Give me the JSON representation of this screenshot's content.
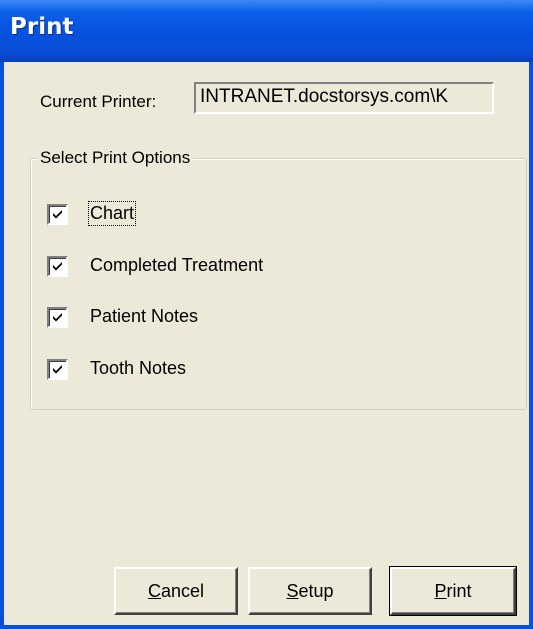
{
  "window": {
    "title": "Print"
  },
  "printer": {
    "label": "Current Printer:",
    "value": "INTRANET.docstorsys.com\\K"
  },
  "options": {
    "group_title": "Select Print Options",
    "items": [
      {
        "label": "Chart",
        "checked": true
      },
      {
        "label": "Completed Treatment",
        "checked": true
      },
      {
        "label": "Patient Notes",
        "checked": true
      },
      {
        "label": "Tooth Notes",
        "checked": true
      }
    ]
  },
  "buttons": {
    "cancel": {
      "mnemonic": "C",
      "rest": "ancel"
    },
    "setup": {
      "mnemonic": "S",
      "rest": "etup"
    },
    "print": {
      "mnemonic": "P",
      "rest": "rint"
    }
  },
  "colors": {
    "titlebar": "#0a4fd8",
    "dialog_bg": "#ece9d8"
  }
}
